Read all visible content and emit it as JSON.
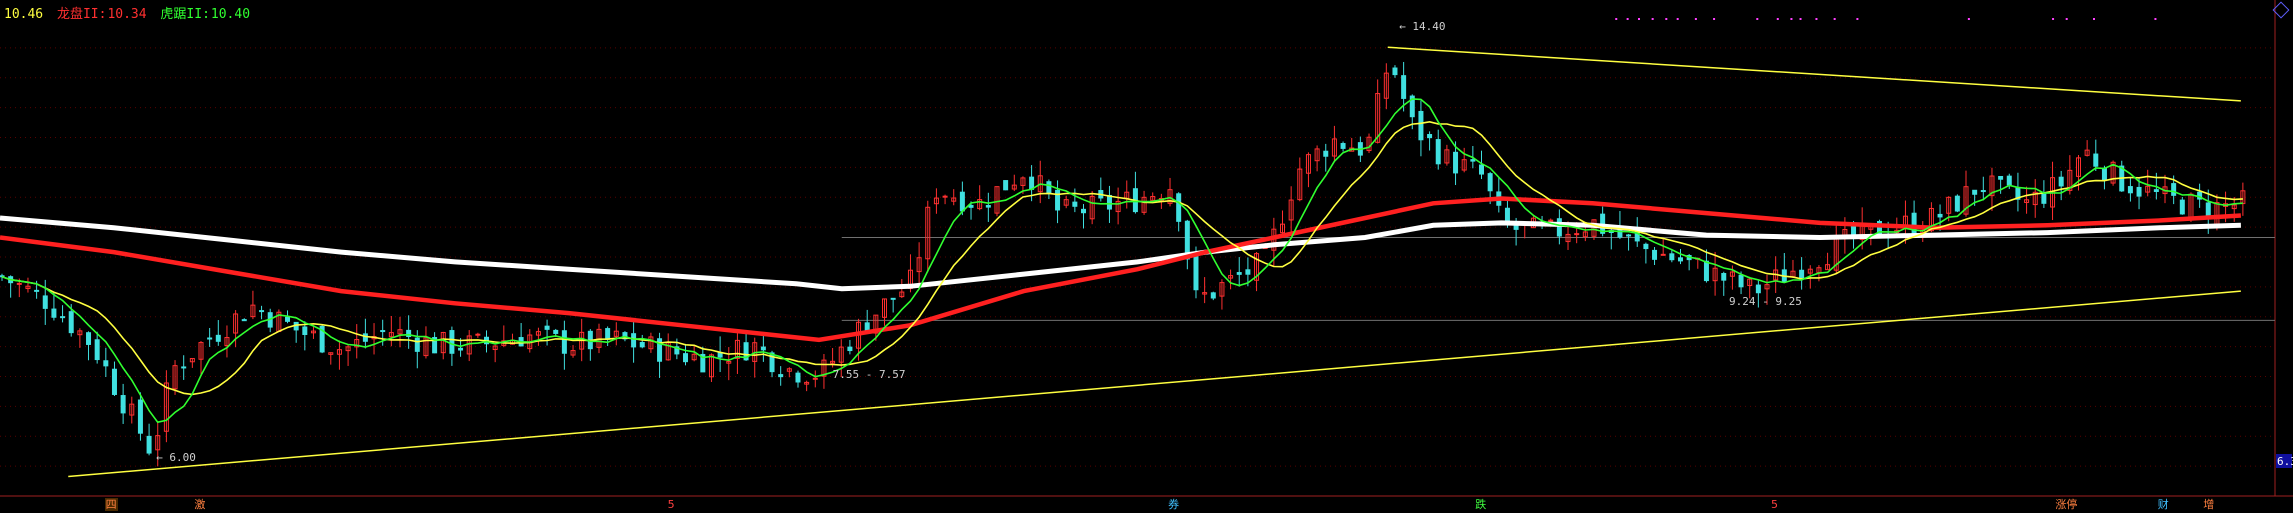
{
  "header": {
    "time": "10.46",
    "items": [
      {
        "label": "龙盘II:",
        "value": "10.34",
        "color": "#ff3030"
      },
      {
        "label": "虎踞II:",
        "value": "10.40",
        "color": "#30ff30"
      }
    ]
  },
  "price_annotations": {
    "high": "14.40",
    "low": "6.00",
    "range_mid": "7.55 - 7.57",
    "range_right": "9.24 - 9.25",
    "right_tag": "6.3"
  },
  "bottom_labels": [
    {
      "text": "四",
      "color": "#ff8040"
    },
    {
      "text": "激",
      "color": "#ff8040"
    },
    {
      "text": "5",
      "color": "#ff4040"
    },
    {
      "text": "券",
      "color": "#40c0ff"
    },
    {
      "text": "跌",
      "color": "#40ff40"
    },
    {
      "text": "5",
      "color": "#ff4040"
    },
    {
      "text": "涨停",
      "color": "#ff8040"
    },
    {
      "text": "财",
      "color": "#40c0ff"
    },
    {
      "text": "增",
      "color": "#ff8040"
    }
  ],
  "chart_data": {
    "type": "candlestick",
    "ylim": [
      5.2,
      15.0
    ],
    "colors": {
      "up": "#ff3030",
      "down": "#40e0e0",
      "ma_fast": "#30ff30",
      "ma_mid": "#ffff40",
      "ma_long": "#ff2020",
      "ma_longest": "#ffffff",
      "trendline": "#ffff40",
      "marker": "#ff40ff"
    },
    "trend_upper": [
      [
        14.4,
        13.3
      ],
      [
        0.61,
        0.985
      ]
    ],
    "trend_lower": [
      [
        5.6,
        9.4
      ],
      [
        0.03,
        0.985
      ]
    ],
    "h_lines": [
      8.8,
      10.5
    ],
    "path_points": [
      [
        0.0,
        9.7
      ],
      [
        0.02,
        9.2
      ],
      [
        0.04,
        8.3
      ],
      [
        0.055,
        7.0
      ],
      [
        0.066,
        6.1
      ],
      [
        0.075,
        7.8
      ],
      [
        0.09,
        8.4
      ],
      [
        0.11,
        9.1
      ],
      [
        0.13,
        8.6
      ],
      [
        0.15,
        8.2
      ],
      [
        0.17,
        8.6
      ],
      [
        0.19,
        8.3
      ],
      [
        0.21,
        8.3
      ],
      [
        0.23,
        8.5
      ],
      [
        0.25,
        8.3
      ],
      [
        0.27,
        8.4
      ],
      [
        0.29,
        8.2
      ],
      [
        0.31,
        8.0
      ],
      [
        0.33,
        8.3
      ],
      [
        0.345,
        7.8
      ],
      [
        0.36,
        7.7
      ],
      [
        0.38,
        8.8
      ],
      [
        0.4,
        9.6
      ],
      [
        0.41,
        11.5
      ],
      [
        0.43,
        11.2
      ],
      [
        0.45,
        11.9
      ],
      [
        0.465,
        11.0
      ],
      [
        0.48,
        11.1
      ],
      [
        0.5,
        11.3
      ],
      [
        0.515,
        11.6
      ],
      [
        0.525,
        9.2
      ],
      [
        0.54,
        9.6
      ],
      [
        0.555,
        10.0
      ],
      [
        0.57,
        11.9
      ],
      [
        0.585,
        12.5
      ],
      [
        0.6,
        12.3
      ],
      [
        0.61,
        14.2
      ],
      [
        0.62,
        12.8
      ],
      [
        0.635,
        12.1
      ],
      [
        0.65,
        11.8
      ],
      [
        0.66,
        10.7
      ],
      [
        0.68,
        10.6
      ],
      [
        0.7,
        10.8
      ],
      [
        0.72,
        10.3
      ],
      [
        0.74,
        10.0
      ],
      [
        0.76,
        9.6
      ],
      [
        0.77,
        9.4
      ],
      [
        0.79,
        9.9
      ],
      [
        0.81,
        10.4
      ],
      [
        0.83,
        10.7
      ],
      [
        0.85,
        10.9
      ],
      [
        0.87,
        11.6
      ],
      [
        0.89,
        11.2
      ],
      [
        0.905,
        11.6
      ],
      [
        0.915,
        12.3
      ],
      [
        0.93,
        11.7
      ],
      [
        0.95,
        11.3
      ],
      [
        0.97,
        11.1
      ],
      [
        0.985,
        11.2
      ]
    ],
    "ma_long_points": [
      [
        0.0,
        10.5
      ],
      [
        0.05,
        10.2
      ],
      [
        0.1,
        9.8
      ],
      [
        0.15,
        9.4
      ],
      [
        0.2,
        9.15
      ],
      [
        0.25,
        8.95
      ],
      [
        0.3,
        8.7
      ],
      [
        0.34,
        8.5
      ],
      [
        0.36,
        8.4
      ],
      [
        0.4,
        8.7
      ],
      [
        0.45,
        9.4
      ],
      [
        0.5,
        9.85
      ],
      [
        0.53,
        10.2
      ],
      [
        0.56,
        10.5
      ],
      [
        0.6,
        10.9
      ],
      [
        0.63,
        11.2
      ],
      [
        0.66,
        11.3
      ],
      [
        0.7,
        11.2
      ],
      [
        0.75,
        11.0
      ],
      [
        0.8,
        10.8
      ],
      [
        0.85,
        10.7
      ],
      [
        0.9,
        10.75
      ],
      [
        0.95,
        10.85
      ],
      [
        0.985,
        10.95
      ]
    ],
    "ma_longest_points": [
      [
        0.0,
        10.9
      ],
      [
        0.05,
        10.7
      ],
      [
        0.1,
        10.45
      ],
      [
        0.15,
        10.2
      ],
      [
        0.2,
        10.0
      ],
      [
        0.25,
        9.85
      ],
      [
        0.3,
        9.7
      ],
      [
        0.35,
        9.55
      ],
      [
        0.37,
        9.45
      ],
      [
        0.4,
        9.5
      ],
      [
        0.45,
        9.75
      ],
      [
        0.5,
        10.0
      ],
      [
        0.53,
        10.2
      ],
      [
        0.56,
        10.35
      ],
      [
        0.6,
        10.5
      ],
      [
        0.63,
        10.75
      ],
      [
        0.66,
        10.8
      ],
      [
        0.7,
        10.75
      ],
      [
        0.75,
        10.55
      ],
      [
        0.8,
        10.5
      ],
      [
        0.85,
        10.55
      ],
      [
        0.9,
        10.6
      ],
      [
        0.95,
        10.7
      ],
      [
        0.985,
        10.75
      ]
    ]
  }
}
